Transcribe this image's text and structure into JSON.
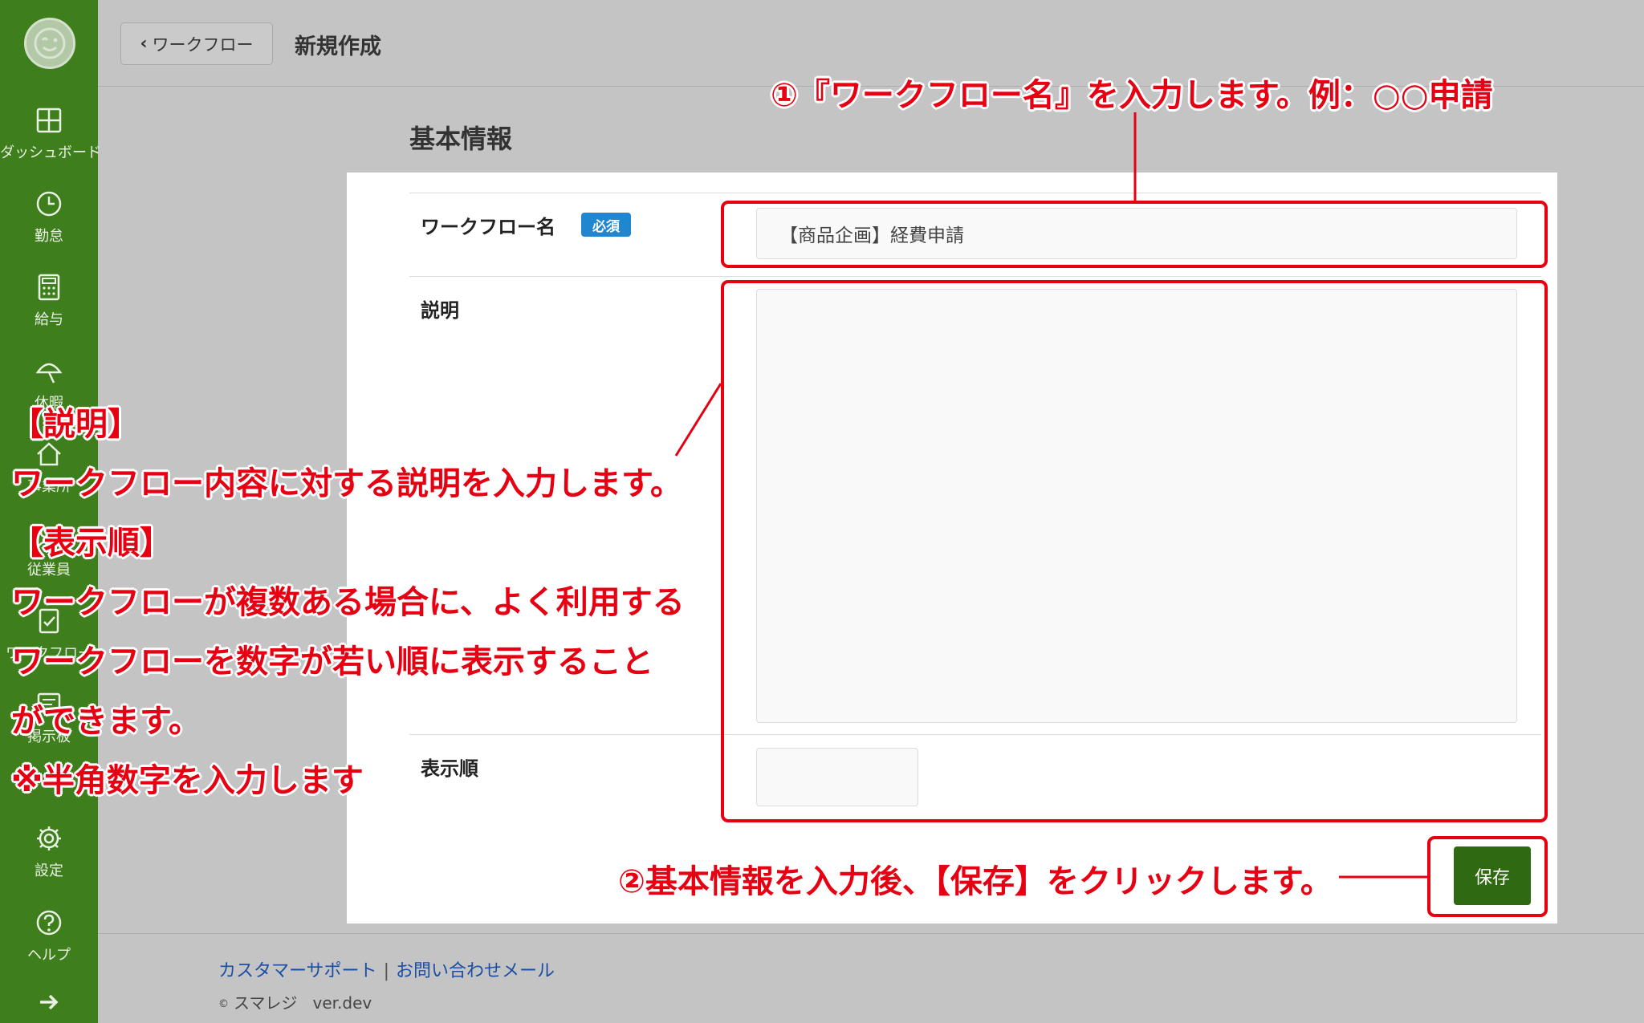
{
  "sidebar": {
    "items": [
      {
        "label": "ダッシュボード",
        "icon": "dashboard-icon"
      },
      {
        "label": "勤怠",
        "icon": "clock-icon"
      },
      {
        "label": "給与",
        "icon": "calculator-icon"
      },
      {
        "label": "休暇",
        "icon": "umbrella-icon"
      },
      {
        "label": "事業所",
        "icon": "home-icon"
      },
      {
        "label": "従業員",
        "icon": "people-icon"
      },
      {
        "label": "ワークフロー",
        "icon": "clipboard-check-icon"
      },
      {
        "label": "掲示板",
        "icon": "board-icon"
      },
      {
        "label": "設定",
        "icon": "gear-icon"
      },
      {
        "label": "ヘルプ",
        "icon": "help-icon"
      }
    ]
  },
  "header": {
    "back_label": "ワークフロー",
    "title": "新規作成"
  },
  "form": {
    "section_title": "基本情報",
    "name_label": "ワークフロー名",
    "required_badge": "必須",
    "name_value": "【商品企画】経費申請",
    "description_label": "説明",
    "description_value": "",
    "order_label": "表示順",
    "order_value": "",
    "save_label": "保存"
  },
  "footer": {
    "support_link": "カスタマーサポート",
    "separator": "|",
    "contact_link": "お問い合わせメール",
    "copyright": "©",
    "brand": "スマレジ",
    "version": "ver.dev"
  },
  "annotations": {
    "step1": "①『ワークフロー名』を入力します。例：○○申請",
    "step2": "②基本情報を入力後、【保存】をクリックします。",
    "desc_heading": "【説明】",
    "desc_body": "ワークフロー内容に対する説明を入力します。",
    "order_heading": "【表示順】",
    "order_line1": "ワークフローが複数ある場合に、よく利用する",
    "order_line2": "ワークフローを数字が若い順に表示すること",
    "order_line3": "ができます。",
    "order_note": "※半角数字を入力します"
  },
  "colors": {
    "sidebar_bg": "#3e7e1c",
    "save_button": "#2f6a12",
    "badge_blue": "#1f86cf",
    "annotation_red": "#e60012"
  }
}
